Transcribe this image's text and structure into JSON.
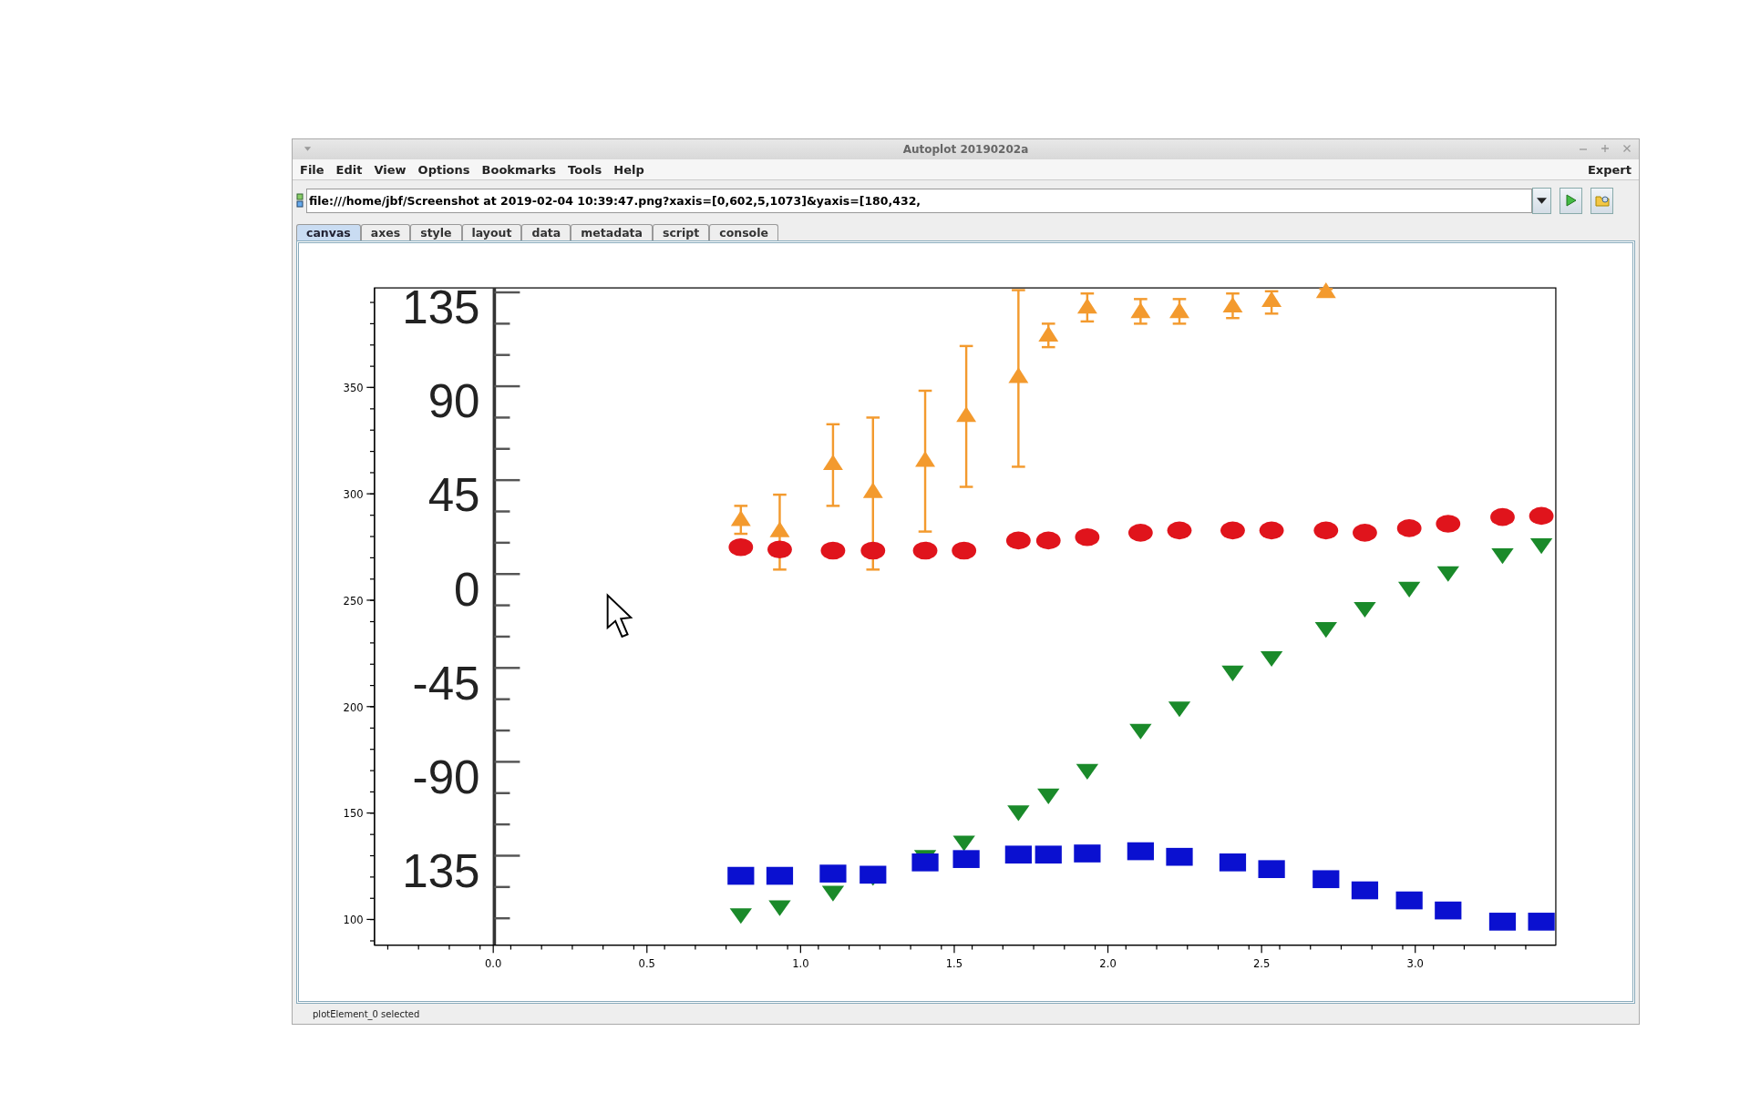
{
  "window": {
    "title": "Autoplot 20190202a"
  },
  "menu": [
    "File",
    "Edit",
    "View",
    "Options",
    "Bookmarks",
    "Tools",
    "Help"
  ],
  "menu_right": "Expert",
  "address": {
    "value": "file:///home/jbf/Screenshot at 2019-02-04 10:39:47.png?xaxis=[0,602,5,1073]&yaxis=[180,432,"
  },
  "tabs": [
    {
      "label": "canvas",
      "selected": true
    },
    {
      "label": "axes",
      "selected": false
    },
    {
      "label": "style",
      "selected": false
    },
    {
      "label": "layout",
      "selected": false
    },
    {
      "label": "data",
      "selected": false
    },
    {
      "label": "metadata",
      "selected": false
    },
    {
      "label": "script",
      "selected": false
    },
    {
      "label": "console",
      "selected": false
    }
  ],
  "plot": {
    "x_ticks": [
      "0.0",
      "0.5",
      "1.0",
      "1.5",
      "2.0",
      "2.5",
      "3.0"
    ],
    "y_ticks": [
      "350",
      "300",
      "250",
      "200",
      "150",
      "100"
    ],
    "image_labels": [
      "135",
      "90",
      "45",
      "0",
      "-45",
      "-90",
      "135"
    ]
  },
  "status_bar": "plotElement_0 selected"
}
